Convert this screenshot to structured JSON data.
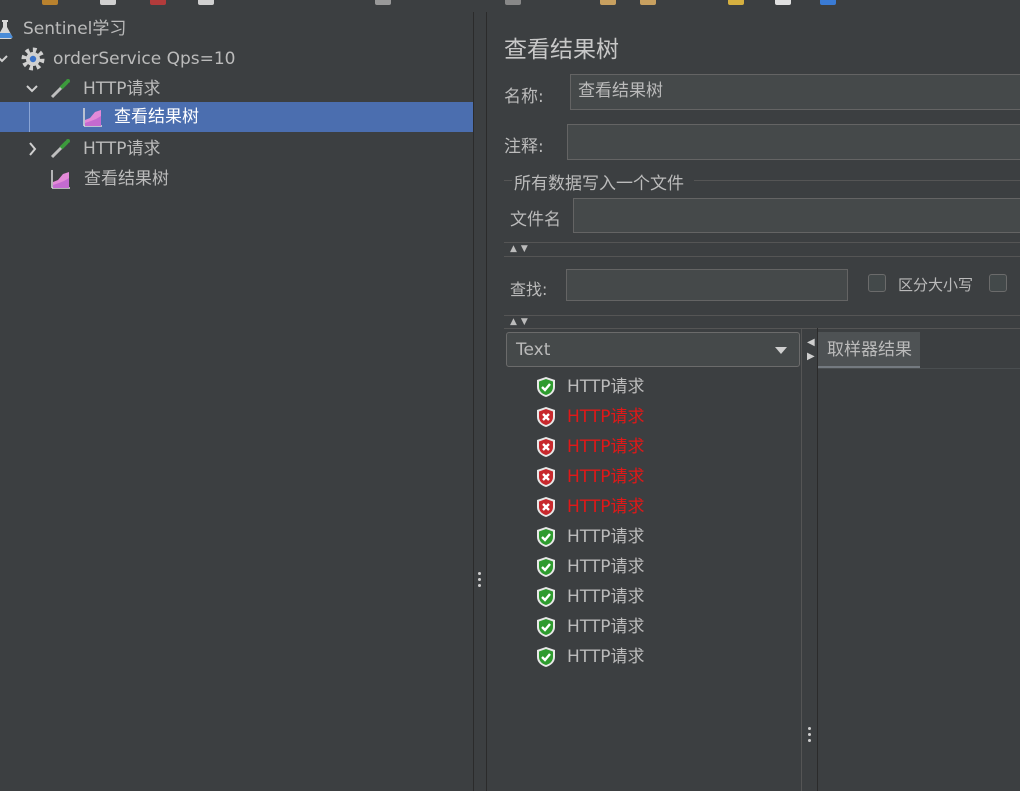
{
  "tree": {
    "items": [
      {
        "label": "Sentinel学习"
      },
      {
        "label": "orderService Qps=10"
      },
      {
        "label": "HTTP请求"
      },
      {
        "label": "查看结果树"
      },
      {
        "label": "HTTP请求"
      },
      {
        "label": "查看结果树"
      }
    ]
  },
  "panel": {
    "title": "查看结果树",
    "name_label": "名称:",
    "name_value": "查看结果树",
    "comment_label": "注释:",
    "comment_value": "",
    "group_title": "所有数据写入一个文件",
    "filename_label": "文件名",
    "filename_value": "",
    "search_label": "查找:",
    "search_value": "",
    "case_sensitive_label": "区分大小写",
    "renderer_selected": "Text",
    "tab_sampler_result": "取样器结果"
  },
  "results": [
    {
      "label": "HTTP请求",
      "status": "success"
    },
    {
      "label": "HTTP请求",
      "status": "error"
    },
    {
      "label": "HTTP请求",
      "status": "error"
    },
    {
      "label": "HTTP请求",
      "status": "error"
    },
    {
      "label": "HTTP请求",
      "status": "error"
    },
    {
      "label": "HTTP请求",
      "status": "success"
    },
    {
      "label": "HTTP请求",
      "status": "success"
    },
    {
      "label": "HTTP请求",
      "status": "success"
    },
    {
      "label": "HTTP请求",
      "status": "success"
    },
    {
      "label": "HTTP请求",
      "status": "success"
    }
  ],
  "colors": {
    "background": "#3c3f41",
    "selection": "#4b6eaf",
    "error_text": "#e01818",
    "success_icon": "#2e9b2e",
    "error_icon": "#c8282c"
  }
}
